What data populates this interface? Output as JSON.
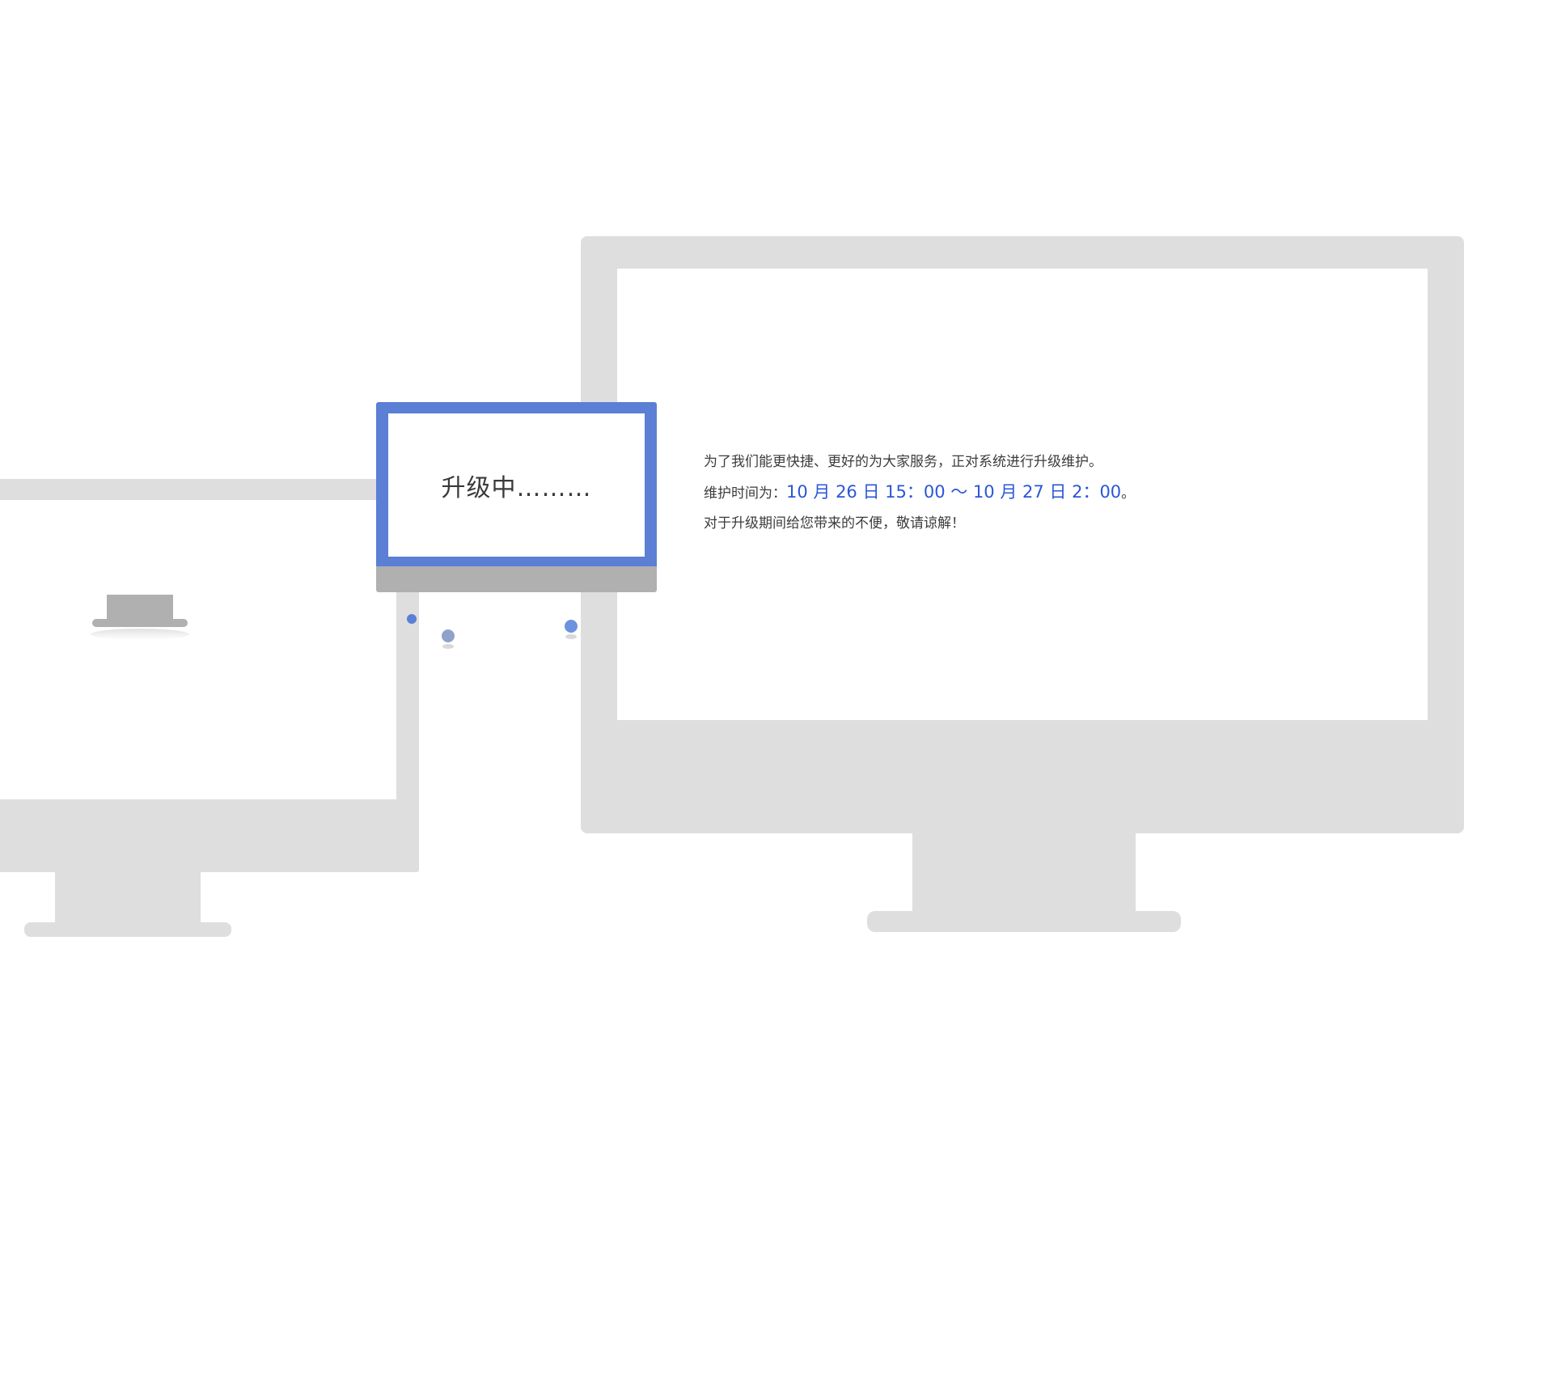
{
  "small_monitor": {
    "screen_text": "升级中………"
  },
  "notice": {
    "line1": "为了我们能更快捷、更好的为大家服务，正对系统进行升级维护。",
    "line2_prefix": "维护时间为：",
    "maintenance_time": "10 月 26 日 15：00 ～ 10 月 27 日 2：00",
    "line2_suffix": "。",
    "line3": "对于升级期间给您带来的不便，敬请谅解！"
  },
  "colors": {
    "accent_blue": "#5a7fd4",
    "time_text_blue": "#2b56d6",
    "monitor_gray": "#dedede",
    "small_monitor_chin": "#b0b0b0"
  }
}
